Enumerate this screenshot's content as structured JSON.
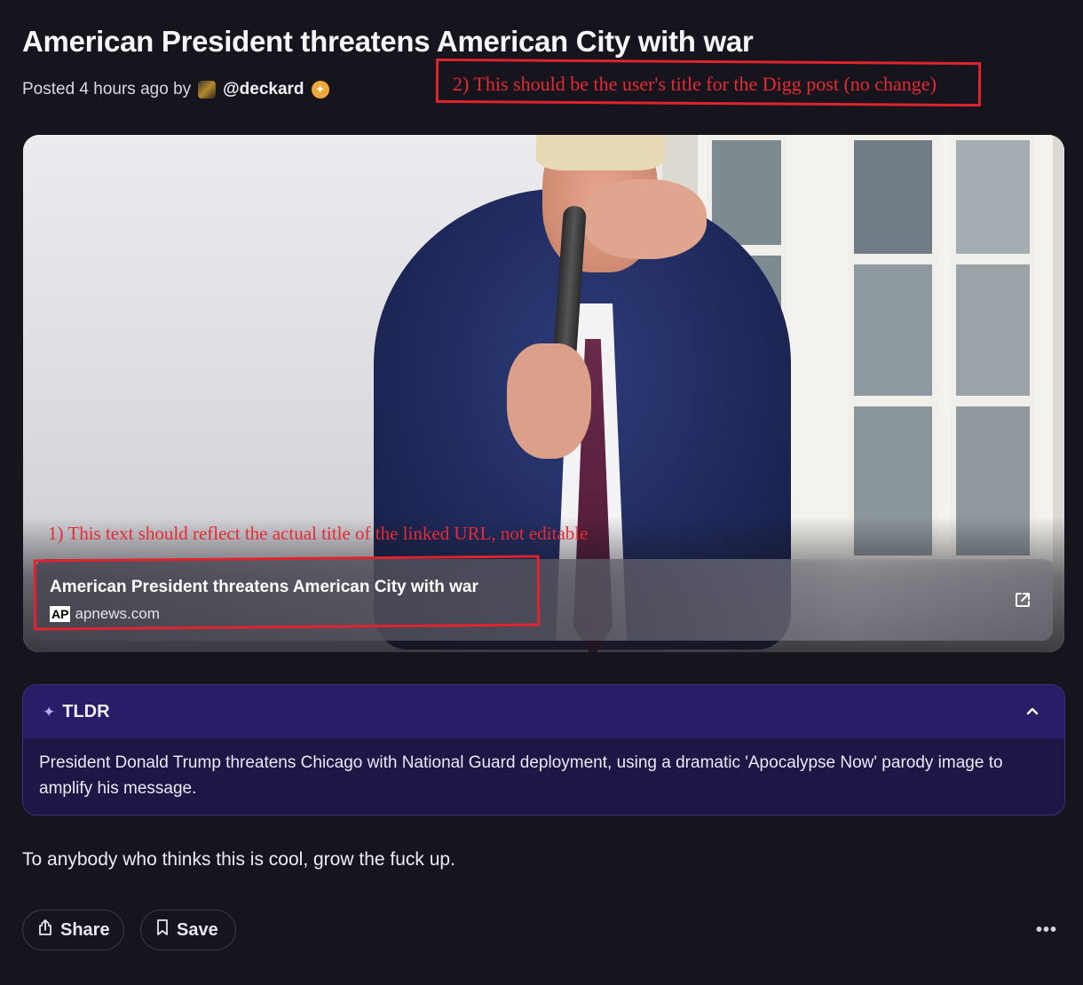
{
  "post": {
    "title": "American President threatens American City with war",
    "posted_prefix": "Posted 4 hours ago by",
    "username": "@deckard",
    "body": "To anybody who thinks this is cool, grow the fuck up."
  },
  "link_card": {
    "title": "American President threatens American City with war",
    "source_logo": "AP",
    "domain": "apnews.com",
    "external_icon": "external-link-icon"
  },
  "tldr": {
    "label": "TLDR",
    "text": "President Donald Trump threatens Chicago with National Guard deployment, using a dramatic 'Apocalypse Now' parody image to amplify his message."
  },
  "actions": {
    "share_label": "Share",
    "save_label": "Save",
    "more_label": "•••"
  },
  "annotations": {
    "note1": "1) This text should reflect the actual title of the linked URL, not editable",
    "note2": "2) This should be the user's title for the Digg post (no change)",
    "color": "#e0242f"
  },
  "colors": {
    "background": "#16151d",
    "tldr_header": "#2a1c67",
    "tldr_body": "#1e1644",
    "badge": "#f0a838"
  }
}
